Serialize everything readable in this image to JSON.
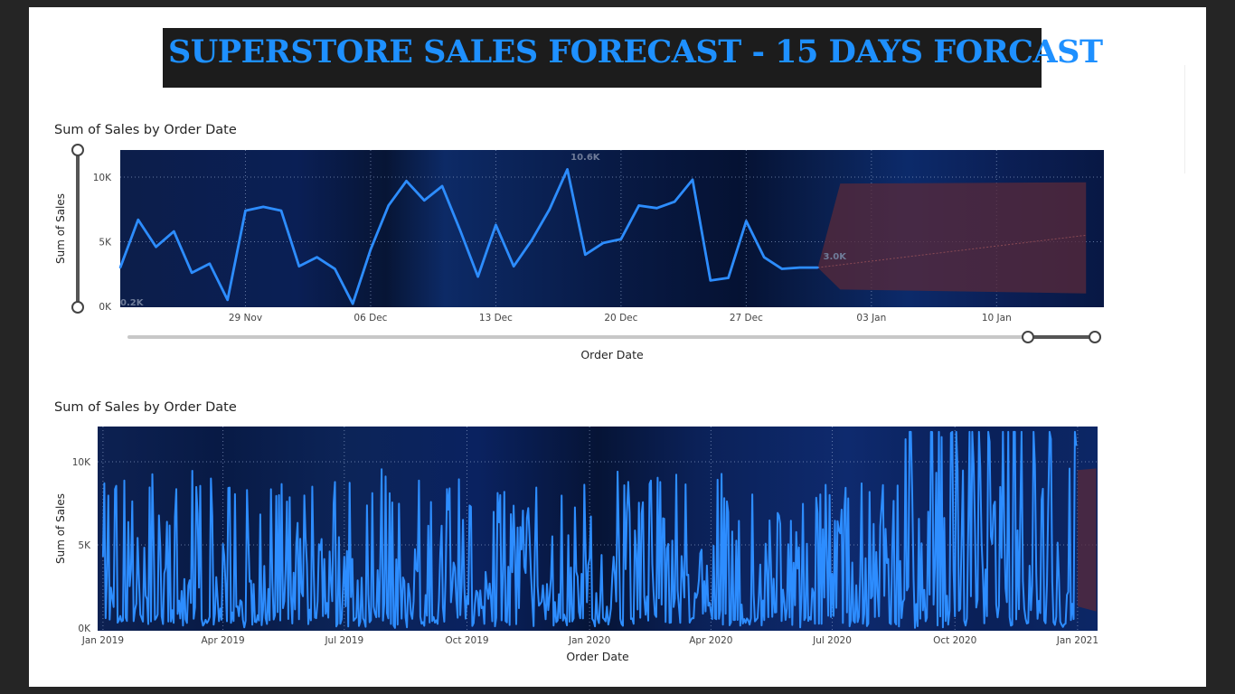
{
  "header": {
    "title": "SUPERSTORE SALES FORECAST - 15 DAYS FORCAST"
  },
  "colors": {
    "line": "#2d8dff",
    "plot_bg": "#0b1c45",
    "forecast_band": "#5a2a3a",
    "title_text": "#1e90ff",
    "title_bg": "#1c1c1c"
  },
  "chart_data": [
    {
      "type": "line",
      "title": "Sum of Sales by Order Date",
      "xlabel": "Order Date",
      "ylabel": "Sum of Sales",
      "x_ticks": [
        "29 Nov",
        "06 Dec",
        "13 Dec",
        "20 Dec",
        "27 Dec",
        "03 Jan",
        "10 Jan"
      ],
      "y_ticks": [
        "0K",
        "5K",
        "10K"
      ],
      "ylim": [
        0,
        12000
      ],
      "grid": true,
      "x": [
        "2020-11-22",
        "2020-11-23",
        "2020-11-24",
        "2020-11-25",
        "2020-11-26",
        "2020-11-27",
        "2020-11-28",
        "2020-11-29",
        "2020-11-30",
        "2020-12-01",
        "2020-12-02",
        "2020-12-03",
        "2020-12-04",
        "2020-12-05",
        "2020-12-06",
        "2020-12-07",
        "2020-12-08",
        "2020-12-09",
        "2020-12-10",
        "2020-12-11",
        "2020-12-12",
        "2020-12-13",
        "2020-12-14",
        "2020-12-15",
        "2020-12-16",
        "2020-12-17",
        "2020-12-18",
        "2020-12-19",
        "2020-12-20",
        "2020-12-21",
        "2020-12-22",
        "2020-12-23",
        "2020-12-24",
        "2020-12-25",
        "2020-12-26",
        "2020-12-27",
        "2020-12-28",
        "2020-12-29",
        "2020-12-30",
        "2020-12-31"
      ],
      "values": [
        3000,
        6700,
        4600,
        5800,
        2600,
        3300,
        500,
        7400,
        7700,
        7400,
        3100,
        3800,
        2900,
        200,
        4400,
        7800,
        9700,
        8200,
        9300,
        5900,
        2300,
        6300,
        3100,
        5100,
        7500,
        10600,
        4000,
        4900,
        5200,
        7800,
        7600,
        8100,
        9800,
        2000,
        2200,
        6600,
        3800,
        2900,
        3000,
        3000
      ],
      "annotations": [
        {
          "x": "2020-12-18",
          "label": "10.6K"
        },
        {
          "x": "2020-12-06",
          "label": "0.2K"
        },
        {
          "x": "2020-12-31",
          "label": "3.0K"
        }
      ],
      "forecast": {
        "start": "2021-01-01",
        "end": "2021-01-15",
        "upper": [
          9500,
          9600
        ],
        "lower": [
          1300,
          1000
        ],
        "point": 5500
      },
      "range_slider": true
    },
    {
      "type": "line",
      "title": "Sum of Sales by Order Date",
      "xlabel": "Order Date",
      "ylabel": "Sum of Sales",
      "x_ticks": [
        "Jan 2019",
        "Apr 2019",
        "Jul 2019",
        "Oct 2019",
        "Jan 2020",
        "Apr 2020",
        "Jul 2020",
        "Oct 2020",
        "Jan 2021"
      ],
      "y_ticks": [
        "0K",
        "5K",
        "10K"
      ],
      "ylim": [
        0,
        12000
      ],
      "grid": true,
      "x_range": [
        "2019-01-01",
        "2020-12-31"
      ],
      "daily_series_note": "",
      "forecast": {
        "start": "2021-01-01",
        "end": "2021-01-15",
        "upper": [
          9500,
          9600
        ],
        "lower": [
          1300,
          1000
        ]
      }
    }
  ],
  "charts": {
    "top": {
      "title": "Sum of Sales by Order Date",
      "xlabel": "Order Date",
      "ylabel": "Sum of Sales"
    },
    "bottom": {
      "title": "Sum of Sales by Order Date",
      "xlabel": "Order Date",
      "ylabel": "Sum of Sales"
    }
  }
}
